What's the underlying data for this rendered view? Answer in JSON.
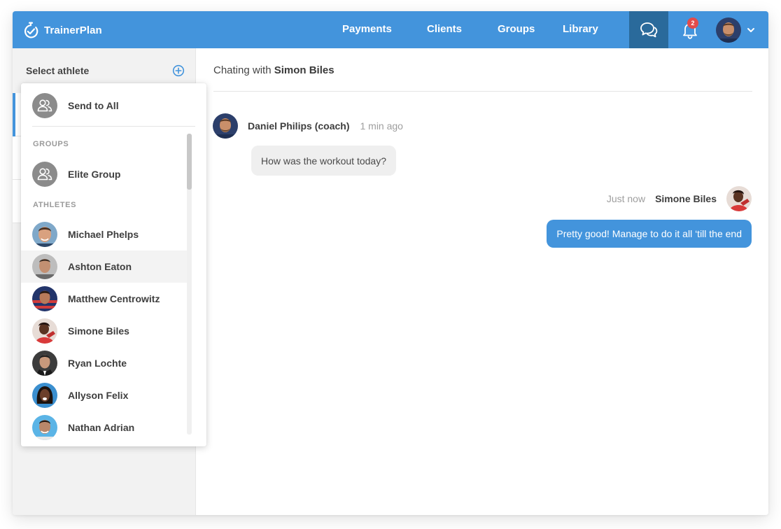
{
  "app": {
    "name": "TrainerPlan"
  },
  "nav": {
    "items": [
      {
        "label": "Payments"
      },
      {
        "label": "Clients"
      },
      {
        "label": "Groups"
      },
      {
        "label": "Library"
      }
    ],
    "notifications_count": "2",
    "icons": {
      "chat": "chat-bubbles-icon",
      "bell": "bell-icon",
      "caret": "chevron-down-icon"
    }
  },
  "sidebar": {
    "title": "Select athlete",
    "add_icon": "plus-circle-icon"
  },
  "dropdown": {
    "send_all": "Send to All",
    "groups_label": "GROUPS",
    "groups": [
      {
        "name": "Elite Group"
      }
    ],
    "athletes_label": "ATHLETES",
    "athletes": [
      {
        "name": "Michael Phelps"
      },
      {
        "name": "Ashton Eaton"
      },
      {
        "name": "Matthew Centrowitz"
      },
      {
        "name": "Simone Biles"
      },
      {
        "name": "Ryan Lochte"
      },
      {
        "name": "Allyson Felix"
      },
      {
        "name": "Nathan Adrian"
      }
    ]
  },
  "chat": {
    "header_prefix": "Chating with",
    "header_name": "Simon Biles",
    "messages": [
      {
        "sender": "Daniel Philips (coach)",
        "time": "1 min ago",
        "text": "How was the workout today?",
        "direction": "incoming"
      },
      {
        "sender": "Simone Biles",
        "time": "Just now",
        "text": "Pretty good! Manage to do it all ‘till the end",
        "direction": "outgoing"
      }
    ]
  },
  "colors": {
    "primary": "#4394dc",
    "primary_dark": "#2a6a9b",
    "badge": "#e24b4b",
    "bubble_in": "#efefef"
  }
}
